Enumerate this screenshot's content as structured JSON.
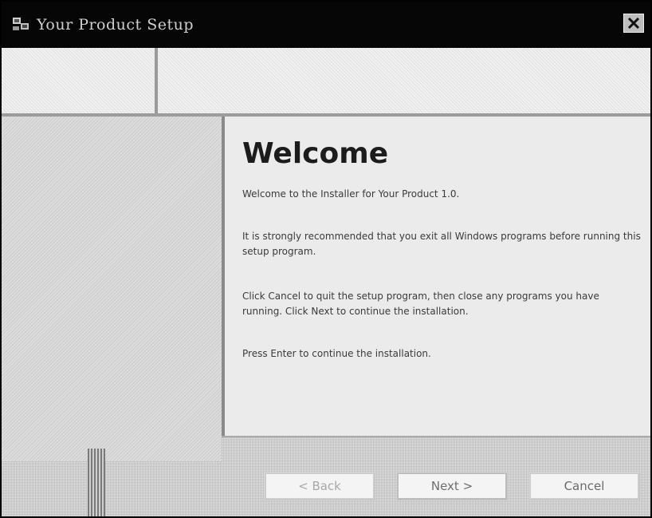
{
  "window": {
    "title": "Your Product Setup",
    "close_label": "X"
  },
  "welcome": {
    "heading": "Welcome",
    "paragraphs": [
      "Welcome to the Installer for Your Product 1.0.",
      "It is strongly recommended that you exit all Windows programs before running this setup program.",
      "Click Cancel to quit the setup program, then close any programs you have running. Click Next to continue the installation.",
      "Press Enter to continue the installation."
    ]
  },
  "buttons": {
    "back": "< Back",
    "next": "Next >",
    "cancel": "Cancel"
  },
  "colors": {
    "titlebar": "#060606",
    "window_bg": "#e4e4e4",
    "content_bg": "#ebebeb"
  }
}
